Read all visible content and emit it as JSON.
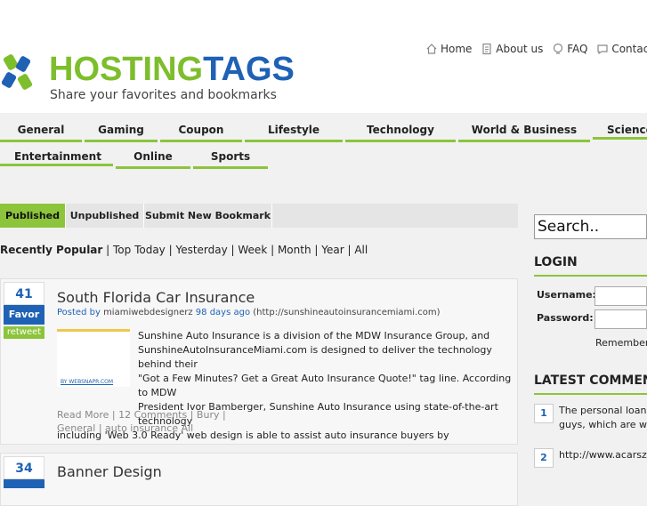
{
  "brand": {
    "name_part1": "HOSTING",
    "name_part2": "TAGS",
    "tagline": "Share your favorites and bookmarks",
    "colors": {
      "green": "#7dbe2c",
      "blue": "#1f62b5"
    }
  },
  "topnav": [
    {
      "label": "Home",
      "icon": "home-icon"
    },
    {
      "label": "About us",
      "icon": "document-icon"
    },
    {
      "label": "FAQ",
      "icon": "faq-icon"
    },
    {
      "label": "Contact u",
      "icon": "contact-icon"
    }
  ],
  "categories_row1": [
    "General",
    "Gaming",
    "Coupon",
    "Lifestyle",
    "Technology",
    "World & Business",
    "Science"
  ],
  "categories_row2": [
    "Entertainment",
    "Online",
    "Sports"
  ],
  "tabs": [
    "Published",
    "Unpublished",
    "Submit New Bookmark"
  ],
  "filter": {
    "label": "Recently Popular",
    "items": [
      "Top Today",
      "Yesterday",
      "Week",
      "Month",
      "Year",
      "All"
    ]
  },
  "posts": [
    {
      "votes": "41",
      "favor": "Favor",
      "retweet": "retweet",
      "title": "South Florida Car Insurance",
      "posted_by": "Posted by",
      "author": "miamiwebdesignerz",
      "age": "98 days ago",
      "url": "(http://sunshineautoinsurancemiami.com)",
      "thumb_label": "BY WEBSNAPR.COM",
      "desc_lines": [
        "Sunshine Auto Insurance is a division of the MDW Insurance Group, and",
        "SunshineAutoInsuranceMiami.com is designed to deliver the technology behind their",
        "\"Got a Few Minutes? Get a Great Auto Insurance Quote!\" tag line. According to MDW",
        "President Ivor Bamberger, Sunshine Auto Insurance using state-of-the-art technology",
        "including 'Web 3.0 Ready' web design is able to assist auto insurance buyers by"
      ],
      "foot_line1": "Read More | 12 Comments  | Bury |",
      "foot_line2": "General     | auto insurance All"
    },
    {
      "votes": "34",
      "title": "Banner Design"
    }
  ],
  "sidebar": {
    "search_placeholder": "Search..",
    "login_title": "LOGIN",
    "username_label": "Username:",
    "password_label": "Password:",
    "remember_label": "Remember:",
    "comments_title": "LATEST COMMEN",
    "comments": [
      {
        "num": "1",
        "lines": [
          "The personal loans",
          "guys, which are willi"
        ]
      },
      {
        "num": "2",
        "lines": [
          "http://www.acarsz.co"
        ]
      }
    ]
  }
}
